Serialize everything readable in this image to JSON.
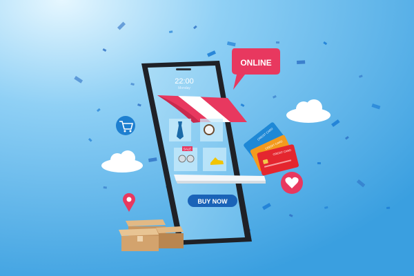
{
  "phone": {
    "clock_time": "22:00",
    "clock_day": "Monday",
    "sale_tag": "SALE",
    "buy_button_label": "BUY NOW"
  },
  "speech_bubble": {
    "label": "ONLINE"
  },
  "credit_cards": [
    {
      "label": "CREDIT CARD",
      "color": "#1e88d6"
    },
    {
      "label": "CREDIT CARD",
      "color": "#f39a1e"
    },
    {
      "label": "CREDIT CARD",
      "color": "#e4262f"
    }
  ],
  "colors": {
    "accent_red": "#e8385f",
    "button_blue": "#1a63b8",
    "background": "#45a7e4"
  }
}
